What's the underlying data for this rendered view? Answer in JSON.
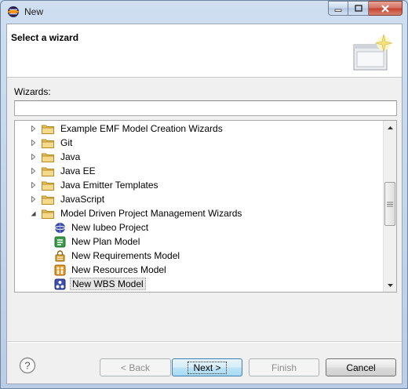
{
  "window": {
    "title": "New"
  },
  "banner": {
    "title": "Select a wizard"
  },
  "filter": {
    "label": "Wizards:",
    "value": ""
  },
  "tree": {
    "items": [
      {
        "label": "Example EMF Model Creation Wizards",
        "kind": "folder",
        "expanded": false
      },
      {
        "label": "Git",
        "kind": "folder",
        "expanded": false
      },
      {
        "label": "Java",
        "kind": "folder",
        "expanded": false
      },
      {
        "label": "Java EE",
        "kind": "folder",
        "expanded": false
      },
      {
        "label": "Java Emitter Templates",
        "kind": "folder",
        "expanded": false
      },
      {
        "label": "JavaScript",
        "kind": "folder",
        "expanded": false
      },
      {
        "label": "Model Driven Project Management Wizards",
        "kind": "folder",
        "expanded": true
      },
      {
        "label": "New Iubeo Project",
        "kind": "wizard",
        "icon": "globe-icon"
      },
      {
        "label": "New Plan Model",
        "kind": "wizard",
        "icon": "plan-model-icon"
      },
      {
        "label": "New Requirements Model",
        "kind": "wizard",
        "icon": "requirements-model-icon"
      },
      {
        "label": "New Resources Model",
        "kind": "wizard",
        "icon": "resources-model-icon"
      },
      {
        "label": "New WBS Model",
        "kind": "wizard",
        "icon": "wbs-model-icon",
        "selected": true
      }
    ]
  },
  "buttons": {
    "back": "< Back",
    "next": "Next >",
    "finish": "Finish",
    "cancel": "Cancel"
  },
  "colors": {
    "accent": "#3c7fb1",
    "folder": "#e8c062"
  }
}
